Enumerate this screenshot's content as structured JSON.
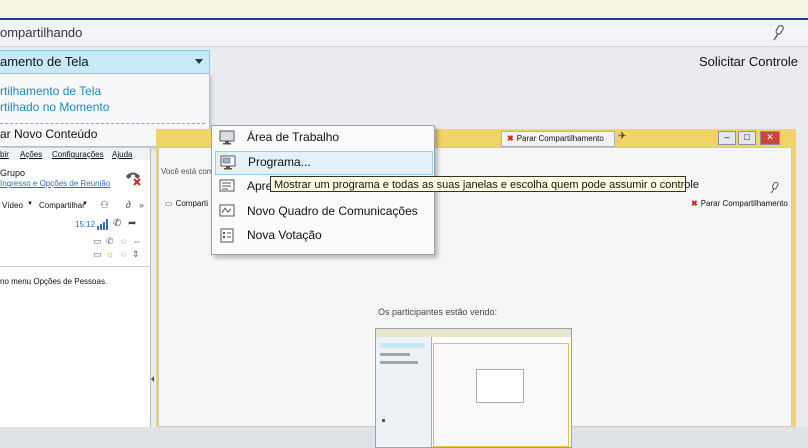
{
  "window": {
    "title": "ompartilhando"
  },
  "dropdown": {
    "selected": "amento de Tela"
  },
  "solicitar_label": "Solicitar Controle",
  "share_menu": {
    "items": [
      "rtilhamento de Tela",
      "rtilhado no Momento"
    ],
    "new_content": "ar Novo Conteúdo"
  },
  "content_menu": {
    "items": [
      {
        "label": "Área de Trabalho",
        "icon": "monitor-icon"
      },
      {
        "label": "Programa...",
        "icon": "program-icon",
        "selected": true
      },
      {
        "label": "Apre",
        "icon": "presentation-icon"
      },
      {
        "label": "Novo Quadro de Comunicações",
        "icon": "whiteboard-icon"
      },
      {
        "label": "Nova Votação",
        "icon": "poll-icon"
      }
    ]
  },
  "tooltip": "Mostrar um programa e todas as suas janelas e escolha quem pode assumir o controle",
  "left_panel": {
    "menu": [
      "bir",
      "Ações",
      "Configurações",
      "Ajuda"
    ],
    "group": "Grupo",
    "group_link": "Ingresso e Opções de Reunião",
    "toolbar": [
      "Vídeo",
      "Compartilhar"
    ],
    "time": "15:12",
    "list_text": "no menu Opções de Pessoas."
  },
  "shared_window": {
    "stop_button": "Parar Compartilhamento",
    "voce": "Você está comp",
    "comp": "Comparti",
    "stop_button2": "Parar Compartilhamento",
    "participants": "Os participantes estão vendo:"
  },
  "colors": {
    "accent": "#c6eaf8",
    "link": "#1a8ab8",
    "stop": "#d6231b",
    "frame": "#f0d46a"
  }
}
